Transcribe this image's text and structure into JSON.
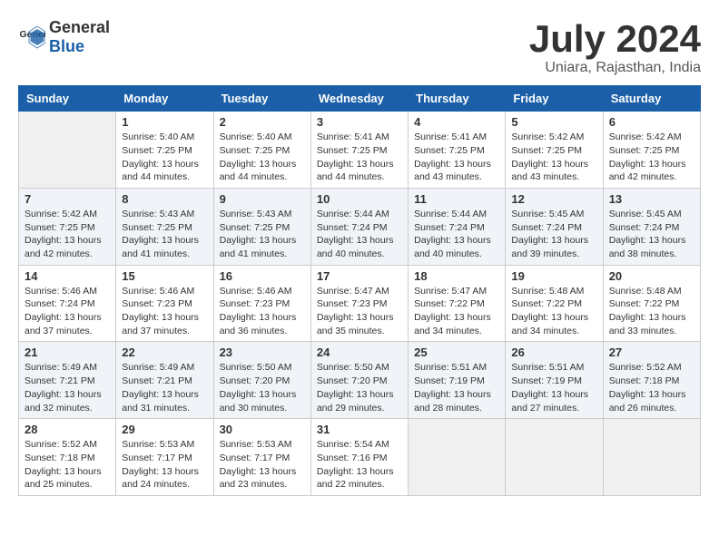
{
  "header": {
    "logo_general": "General",
    "logo_blue": "Blue",
    "month_year": "July 2024",
    "location": "Uniara, Rajasthan, India"
  },
  "weekdays": [
    "Sunday",
    "Monday",
    "Tuesday",
    "Wednesday",
    "Thursday",
    "Friday",
    "Saturday"
  ],
  "weeks": [
    [
      {
        "day": "",
        "empty": true
      },
      {
        "day": "1",
        "sunrise": "Sunrise: 5:40 AM",
        "sunset": "Sunset: 7:25 PM",
        "daylight": "Daylight: 13 hours and 44 minutes."
      },
      {
        "day": "2",
        "sunrise": "Sunrise: 5:40 AM",
        "sunset": "Sunset: 7:25 PM",
        "daylight": "Daylight: 13 hours and 44 minutes."
      },
      {
        "day": "3",
        "sunrise": "Sunrise: 5:41 AM",
        "sunset": "Sunset: 7:25 PM",
        "daylight": "Daylight: 13 hours and 44 minutes."
      },
      {
        "day": "4",
        "sunrise": "Sunrise: 5:41 AM",
        "sunset": "Sunset: 7:25 PM",
        "daylight": "Daylight: 13 hours and 43 minutes."
      },
      {
        "day": "5",
        "sunrise": "Sunrise: 5:42 AM",
        "sunset": "Sunset: 7:25 PM",
        "daylight": "Daylight: 13 hours and 43 minutes."
      },
      {
        "day": "6",
        "sunrise": "Sunrise: 5:42 AM",
        "sunset": "Sunset: 7:25 PM",
        "daylight": "Daylight: 13 hours and 42 minutes."
      }
    ],
    [
      {
        "day": "7",
        "sunrise": "Sunrise: 5:42 AM",
        "sunset": "Sunset: 7:25 PM",
        "daylight": "Daylight: 13 hours and 42 minutes."
      },
      {
        "day": "8",
        "sunrise": "Sunrise: 5:43 AM",
        "sunset": "Sunset: 7:25 PM",
        "daylight": "Daylight: 13 hours and 41 minutes."
      },
      {
        "day": "9",
        "sunrise": "Sunrise: 5:43 AM",
        "sunset": "Sunset: 7:25 PM",
        "daylight": "Daylight: 13 hours and 41 minutes."
      },
      {
        "day": "10",
        "sunrise": "Sunrise: 5:44 AM",
        "sunset": "Sunset: 7:24 PM",
        "daylight": "Daylight: 13 hours and 40 minutes."
      },
      {
        "day": "11",
        "sunrise": "Sunrise: 5:44 AM",
        "sunset": "Sunset: 7:24 PM",
        "daylight": "Daylight: 13 hours and 40 minutes."
      },
      {
        "day": "12",
        "sunrise": "Sunrise: 5:45 AM",
        "sunset": "Sunset: 7:24 PM",
        "daylight": "Daylight: 13 hours and 39 minutes."
      },
      {
        "day": "13",
        "sunrise": "Sunrise: 5:45 AM",
        "sunset": "Sunset: 7:24 PM",
        "daylight": "Daylight: 13 hours and 38 minutes."
      }
    ],
    [
      {
        "day": "14",
        "sunrise": "Sunrise: 5:46 AM",
        "sunset": "Sunset: 7:24 PM",
        "daylight": "Daylight: 13 hours and 37 minutes."
      },
      {
        "day": "15",
        "sunrise": "Sunrise: 5:46 AM",
        "sunset": "Sunset: 7:23 PM",
        "daylight": "Daylight: 13 hours and 37 minutes."
      },
      {
        "day": "16",
        "sunrise": "Sunrise: 5:46 AM",
        "sunset": "Sunset: 7:23 PM",
        "daylight": "Daylight: 13 hours and 36 minutes."
      },
      {
        "day": "17",
        "sunrise": "Sunrise: 5:47 AM",
        "sunset": "Sunset: 7:23 PM",
        "daylight": "Daylight: 13 hours and 35 minutes."
      },
      {
        "day": "18",
        "sunrise": "Sunrise: 5:47 AM",
        "sunset": "Sunset: 7:22 PM",
        "daylight": "Daylight: 13 hours and 34 minutes."
      },
      {
        "day": "19",
        "sunrise": "Sunrise: 5:48 AM",
        "sunset": "Sunset: 7:22 PM",
        "daylight": "Daylight: 13 hours and 34 minutes."
      },
      {
        "day": "20",
        "sunrise": "Sunrise: 5:48 AM",
        "sunset": "Sunset: 7:22 PM",
        "daylight": "Daylight: 13 hours and 33 minutes."
      }
    ],
    [
      {
        "day": "21",
        "sunrise": "Sunrise: 5:49 AM",
        "sunset": "Sunset: 7:21 PM",
        "daylight": "Daylight: 13 hours and 32 minutes."
      },
      {
        "day": "22",
        "sunrise": "Sunrise: 5:49 AM",
        "sunset": "Sunset: 7:21 PM",
        "daylight": "Daylight: 13 hours and 31 minutes."
      },
      {
        "day": "23",
        "sunrise": "Sunrise: 5:50 AM",
        "sunset": "Sunset: 7:20 PM",
        "daylight": "Daylight: 13 hours and 30 minutes."
      },
      {
        "day": "24",
        "sunrise": "Sunrise: 5:50 AM",
        "sunset": "Sunset: 7:20 PM",
        "daylight": "Daylight: 13 hours and 29 minutes."
      },
      {
        "day": "25",
        "sunrise": "Sunrise: 5:51 AM",
        "sunset": "Sunset: 7:19 PM",
        "daylight": "Daylight: 13 hours and 28 minutes."
      },
      {
        "day": "26",
        "sunrise": "Sunrise: 5:51 AM",
        "sunset": "Sunset: 7:19 PM",
        "daylight": "Daylight: 13 hours and 27 minutes."
      },
      {
        "day": "27",
        "sunrise": "Sunrise: 5:52 AM",
        "sunset": "Sunset: 7:18 PM",
        "daylight": "Daylight: 13 hours and 26 minutes."
      }
    ],
    [
      {
        "day": "28",
        "sunrise": "Sunrise: 5:52 AM",
        "sunset": "Sunset: 7:18 PM",
        "daylight": "Daylight: 13 hours and 25 minutes."
      },
      {
        "day": "29",
        "sunrise": "Sunrise: 5:53 AM",
        "sunset": "Sunset: 7:17 PM",
        "daylight": "Daylight: 13 hours and 24 minutes."
      },
      {
        "day": "30",
        "sunrise": "Sunrise: 5:53 AM",
        "sunset": "Sunset: 7:17 PM",
        "daylight": "Daylight: 13 hours and 23 minutes."
      },
      {
        "day": "31",
        "sunrise": "Sunrise: 5:54 AM",
        "sunset": "Sunset: 7:16 PM",
        "daylight": "Daylight: 13 hours and 22 minutes."
      },
      {
        "day": "",
        "empty": true
      },
      {
        "day": "",
        "empty": true
      },
      {
        "day": "",
        "empty": true
      }
    ]
  ]
}
